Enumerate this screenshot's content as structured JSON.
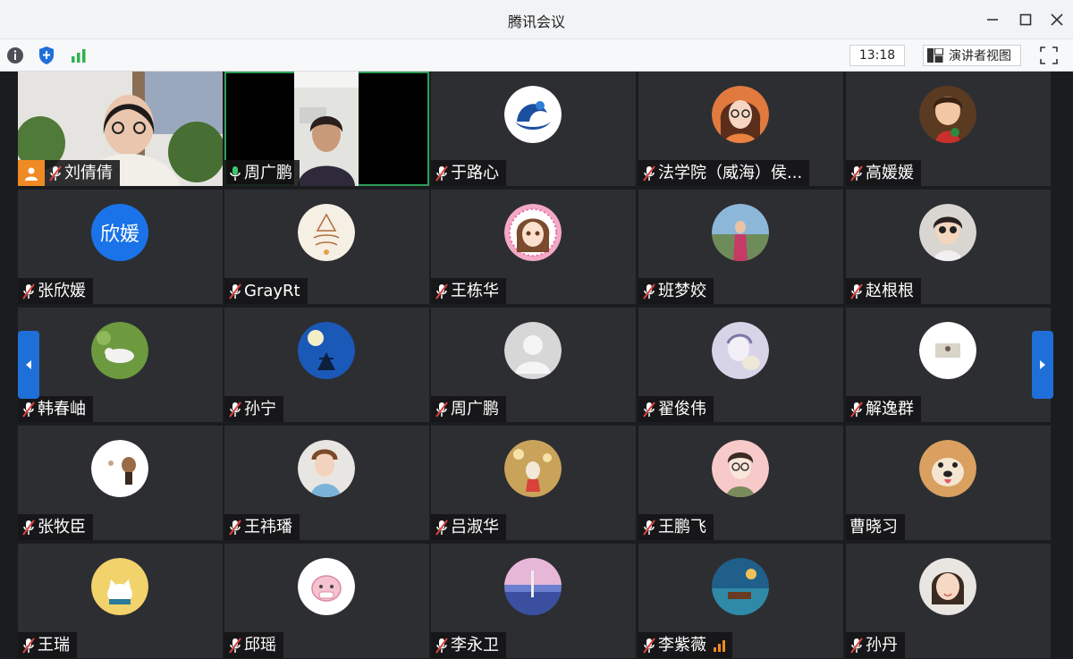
{
  "window": {
    "title": "腾讯会议"
  },
  "toolbar": {
    "time": "13:18",
    "speaker_view_label": "演讲者视图"
  },
  "colors": {
    "host_badge": "#f08a24",
    "active_border": "#2e9c58",
    "nav_blue": "#1f6fd8",
    "mic_muted": "#d9433f"
  },
  "participants": [
    {
      "name": "刘倩倩",
      "mic": "muted",
      "host": true,
      "video": true
    },
    {
      "name": "周广鹏",
      "mic": "on",
      "video": true,
      "active": true
    },
    {
      "name": "于路心",
      "mic": "muted"
    },
    {
      "name": "法学院（威海）侯...",
      "mic": "muted"
    },
    {
      "name": "高媛媛",
      "mic": "muted"
    },
    {
      "name": "张欣媛",
      "mic": "muted",
      "avatar_text": "欣媛"
    },
    {
      "name": "GrayRt",
      "mic": "muted"
    },
    {
      "name": "王栋华",
      "mic": "muted"
    },
    {
      "name": "班梦姣",
      "mic": "muted"
    },
    {
      "name": "赵根根",
      "mic": "muted"
    },
    {
      "name": "韩春岫",
      "mic": "muted"
    },
    {
      "name": "孙宁",
      "mic": "muted"
    },
    {
      "name": "周广鹏",
      "mic": "muted"
    },
    {
      "name": "翟俊伟",
      "mic": "muted"
    },
    {
      "name": "解逸群",
      "mic": "muted"
    },
    {
      "name": "张牧臣",
      "mic": "muted"
    },
    {
      "name": "王祎璠",
      "mic": "muted"
    },
    {
      "name": "吕淑华",
      "mic": "muted"
    },
    {
      "name": "王鹏飞",
      "mic": "muted"
    },
    {
      "name": "曹晓习",
      "mic": "none"
    },
    {
      "name": "王瑞",
      "mic": "muted"
    },
    {
      "name": "邱瑶",
      "mic": "muted"
    },
    {
      "name": "李永卫",
      "mic": "muted"
    },
    {
      "name": "李紫薇",
      "mic": "muted",
      "signal": true
    },
    {
      "name": "孙丹",
      "mic": "muted"
    }
  ]
}
